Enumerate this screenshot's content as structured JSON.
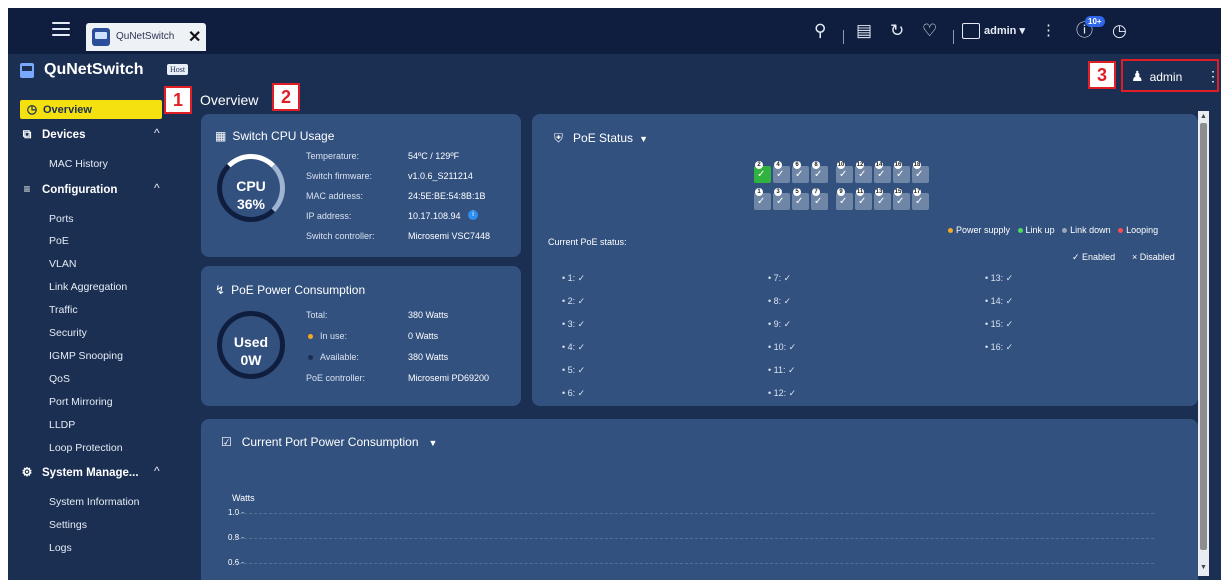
{
  "tab": {
    "label": "QuNetSwitch"
  },
  "topbar": {
    "admin": "admin ▾",
    "badge": "10+"
  },
  "brand": {
    "name": "QuNetSwitch",
    "badge": "Host"
  },
  "sidebar": {
    "overview": "Overview",
    "devices": "Devices",
    "mac_history": "MAC History",
    "configuration": "Configuration",
    "config_items": [
      "Ports",
      "PoE",
      "VLAN",
      "Link Aggregation",
      "Traffic",
      "Security",
      "IGMP Snooping",
      "QoS",
      "Port Mirroring",
      "LLDP",
      "Loop Protection"
    ],
    "system": "System Manage...",
    "system_items": [
      "System Information",
      "Settings",
      "Logs"
    ]
  },
  "callouts": [
    "1",
    "2",
    "3"
  ],
  "page": {
    "title": "Overview",
    "user": "admin"
  },
  "cpu": {
    "title": "Switch CPU Usage",
    "ring_label": "CPU",
    "ring_value": "36%",
    "rows": [
      {
        "k": "Temperature:",
        "v": "54ºC / 129ºF"
      },
      {
        "k": "Switch firmware:",
        "v": "v1.0.6_S211214"
      },
      {
        "k": "MAC address:",
        "v": "24:5E:BE:54:8B:1B"
      },
      {
        "k": "IP address:",
        "v": "10.17.108.94"
      },
      {
        "k": "Switch controller:",
        "v": "Microsemi VSC7448"
      }
    ]
  },
  "poe_power": {
    "title": "PoE Power Consumption",
    "ring_label": "Used",
    "ring_value": "0W",
    "rows": [
      {
        "k": "Total:",
        "v": "380 Watts"
      },
      {
        "k": "In use:",
        "v": "0 Watts"
      },
      {
        "k": "Available:",
        "v": "380 Watts"
      },
      {
        "k": "PoE controller:",
        "v": "Microsemi PD69200"
      }
    ]
  },
  "poe_status": {
    "title": "PoE Status",
    "top_ports": [
      "2",
      "4",
      "6",
      "8",
      "10",
      "12",
      "14",
      "16",
      "18"
    ],
    "bottom_ports": [
      "1",
      "3",
      "5",
      "7",
      "9",
      "11",
      "13",
      "15",
      "17"
    ],
    "legend": [
      "Power supply",
      "Link up",
      "Link down",
      "Looping"
    ],
    "legend_colors": [
      "#f5a623",
      "#4cd964",
      "#9aa7ba",
      "#ff4d4f"
    ],
    "current_label": "Current PoE status:",
    "enabled": "✓ Enabled",
    "disabled": "× Disabled",
    "col1": [
      "•  1:  ✓",
      "•  2:  ✓",
      "•  3:  ✓",
      "•  4:  ✓",
      "•  5:  ✓",
      "•  6:  ✓"
    ],
    "col2": [
      "•  7:  ✓",
      "•  8:  ✓",
      "•  9:  ✓",
      "•  10:  ✓",
      "•  11:  ✓",
      "•  12:  ✓"
    ],
    "col3": [
      "•  13:  ✓",
      "•  14:  ✓",
      "•  15:  ✓",
      "•  16:  ✓"
    ]
  },
  "port_power": {
    "title": "Current Port Power Consumption",
    "unit": "Watts",
    "ticks": [
      "1.0 -",
      "0.8 -",
      "0.6 -"
    ]
  }
}
